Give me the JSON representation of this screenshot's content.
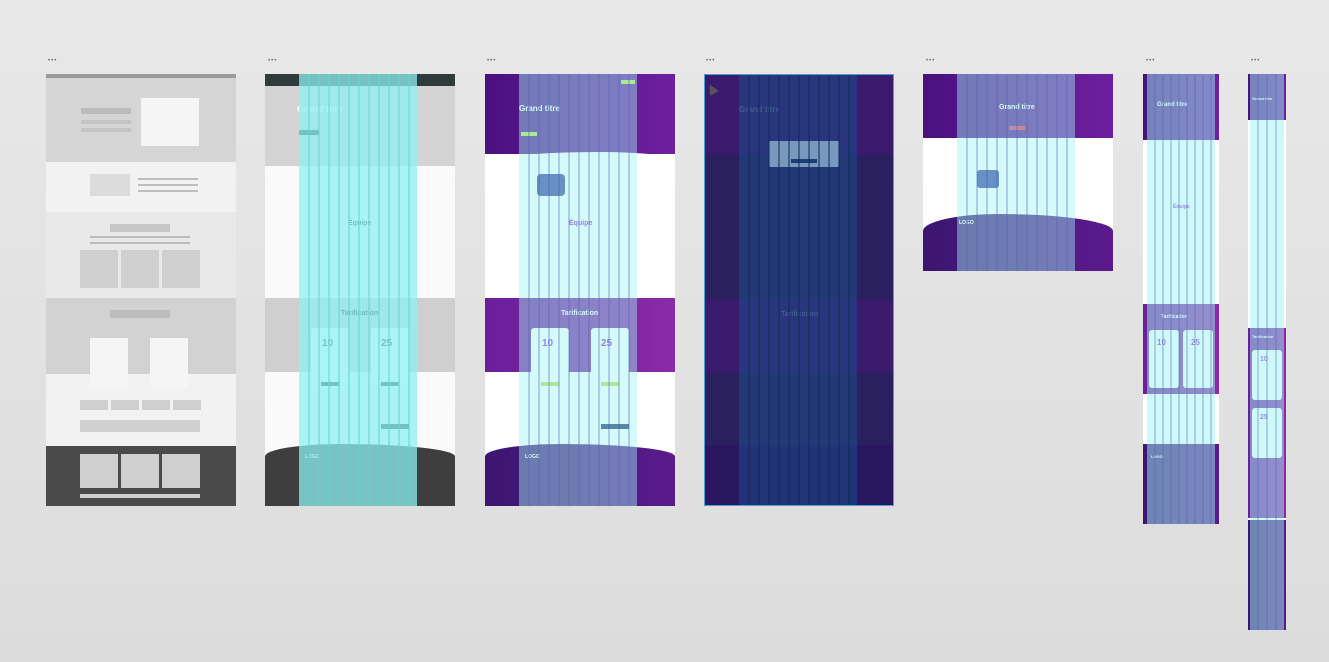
{
  "frame_labels": [
    "•••",
    "•••",
    "•••",
    "•••",
    "•••",
    "•••",
    "•••"
  ],
  "texts": {
    "grand_titre": "Grand titre",
    "equipe": "Équipe",
    "tarification": "Tarification",
    "logo": "LOGO",
    "price_a": "10",
    "price_b": "25",
    "currency": "€"
  },
  "colors": {
    "canvas": "#e6e6e6",
    "purple_dark": "#3b1670",
    "purple": "#6a1f9a",
    "navy": "#1f2a6b",
    "cyan_overlay": "#9ff3f3",
    "lime": "#b6e04b",
    "wire_gray": "#cfcfcf",
    "wire_dark": "#4a4a4a"
  }
}
